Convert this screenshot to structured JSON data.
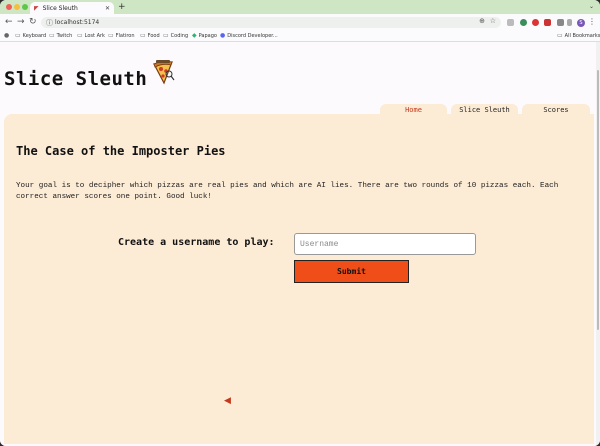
{
  "browser": {
    "tab_title": "Slice Sleuth",
    "tab_close": "✕",
    "new_tab": "+",
    "url": "localhost:5174",
    "bookmarks": [
      {
        "label": "",
        "icon": "github-icon"
      },
      {
        "label": "Keyboard",
        "icon": "folder-icon"
      },
      {
        "label": "Twitch",
        "icon": "folder-icon"
      },
      {
        "label": "Lost Ark",
        "icon": "folder-icon"
      },
      {
        "label": "Flatiron",
        "icon": "folder-icon"
      },
      {
        "label": "Food",
        "icon": "folder-icon"
      },
      {
        "label": "Coding",
        "icon": "folder-icon"
      },
      {
        "label": "Papago",
        "icon": "papago-icon"
      },
      {
        "label": "Discord Developer...",
        "icon": "discord-icon"
      }
    ],
    "all_bookmarks": "All Bookmarks",
    "profile_initial": "S"
  },
  "site": {
    "title": "Slice Sleuth",
    "nav": {
      "home": "Home",
      "sleuth": "Slice Sleuth",
      "scores": "Scores"
    }
  },
  "main": {
    "heading": "The Case of the Imposter Pies",
    "intro": "Your goal is to decipher which pizzas are real pies and which are AI lies. There are two rounds of 10 pizzas each. Each correct answer scores one point. Good luck!",
    "username_label": "Create a username to play:",
    "username_placeholder": "Username",
    "username_value": "",
    "submit_label": "Submit"
  },
  "colors": {
    "panel_bg": "#fcebd5",
    "accent_orange": "#f04e18",
    "active_nav": "#c4391b",
    "tabstrip": "#cfe6c4"
  }
}
